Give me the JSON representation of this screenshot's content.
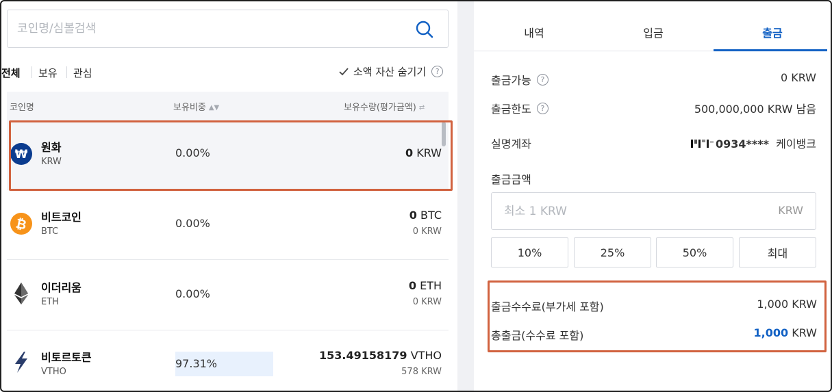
{
  "search": {
    "placeholder": "코인명/심볼검색"
  },
  "filters": {
    "all": "전체",
    "owned": "보유",
    "watch": "관심",
    "hide_small": "소액 자산 숨기기"
  },
  "table": {
    "headers": {
      "name": "코인명",
      "weight": "보유비중",
      "amount": "보유수량(평가금액)"
    },
    "rows": [
      {
        "name": "원화",
        "symbol": "KRW",
        "weight": "0.00%",
        "qty": "0",
        "unit": "KRW",
        "value": ""
      },
      {
        "name": "비트코인",
        "symbol": "BTC",
        "weight": "0.00%",
        "qty": "0",
        "unit": "BTC",
        "value": "0 KRW"
      },
      {
        "name": "이더리움",
        "symbol": "ETH",
        "weight": "0.00%",
        "qty": "0",
        "unit": "ETH",
        "value": "0 KRW"
      },
      {
        "name": "비토르토큰",
        "symbol": "VTHO",
        "weight": "97.31%",
        "weight_fraction": 0.9731,
        "qty": "153.49158179",
        "unit": "VTHO",
        "value": "578 KRW"
      }
    ]
  },
  "tabs": [
    "내역",
    "입금",
    "출금"
  ],
  "withdraw": {
    "available_label": "출금가능",
    "available_value": "0 KRW",
    "limit_label": "출금한도",
    "limit_value": "500,000,000 KRW 남음",
    "account_label": "실명계좌",
    "account_number": "0934****",
    "account_bank": "케이뱅크",
    "amount_label": "출금금액",
    "amount_placeholder": "최소 1 KRW",
    "amount_unit": "KRW",
    "percent_buttons": [
      "10%",
      "25%",
      "50%",
      "최대"
    ],
    "fee_label": "출금수수료(부가세 포함)",
    "fee_value": "1,000 KRW",
    "total_label": "총출금(수수료 포함)",
    "total_number": "1,000",
    "total_unit": "KRW"
  },
  "colors": {
    "accent": "#1261c4",
    "highlight": "#d1623f",
    "selected_row": "#f4f5f8"
  }
}
